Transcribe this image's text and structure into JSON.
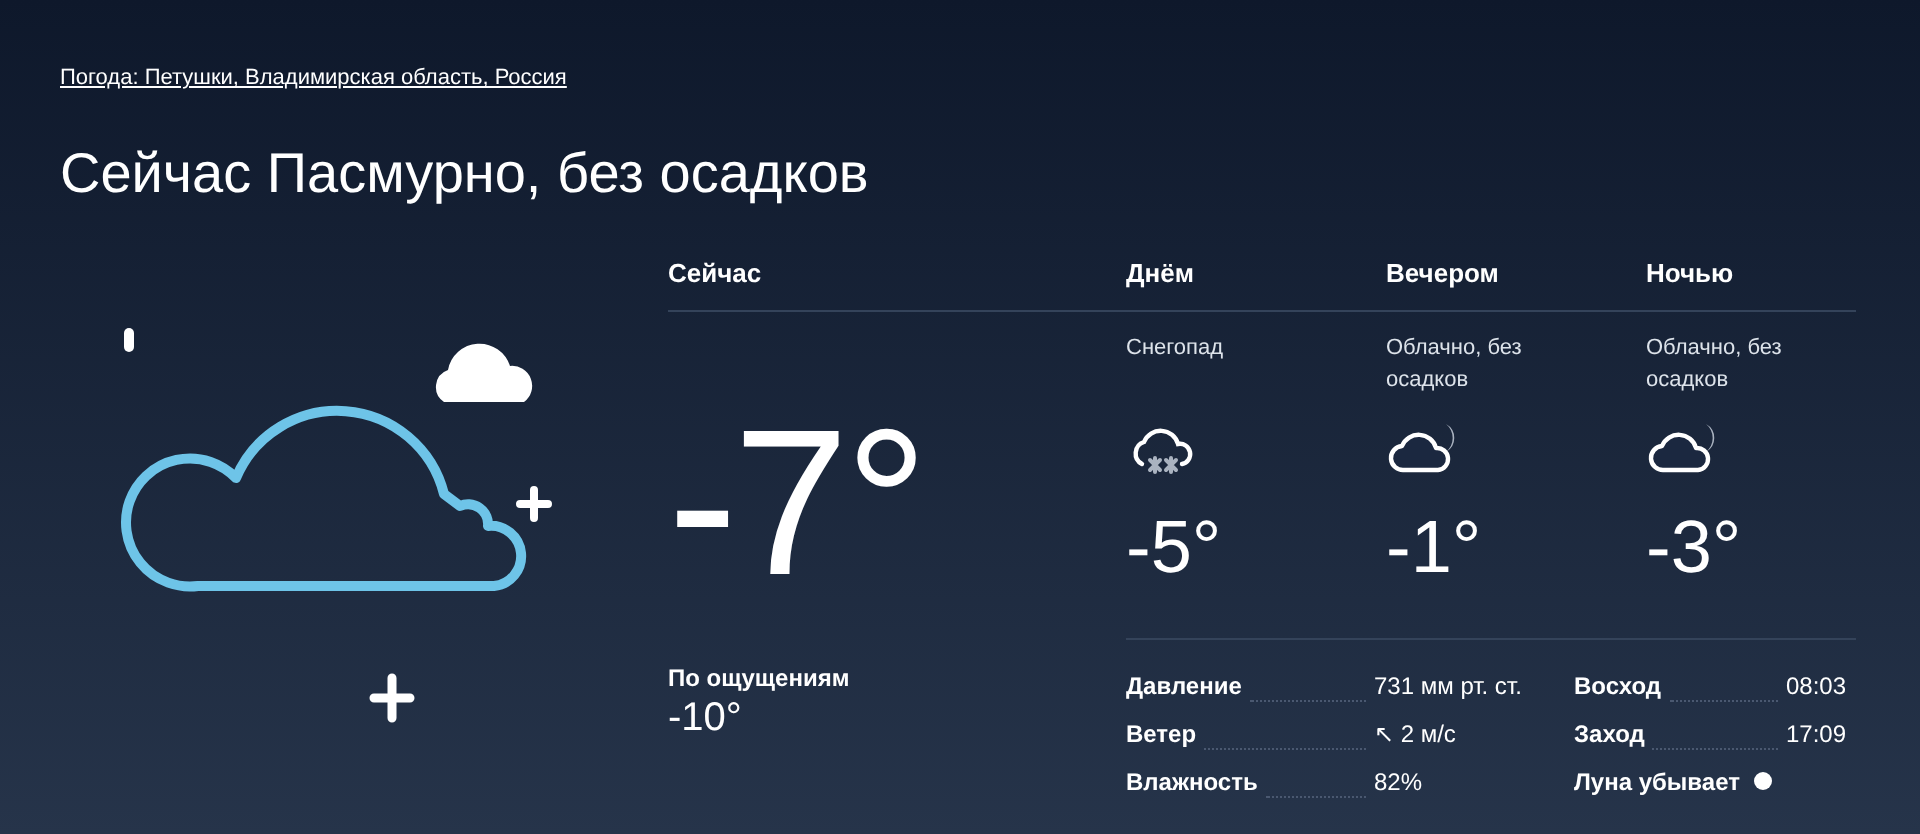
{
  "breadcrumb": "Погода: Петушки, Владимирская область, Россия",
  "title": "Сейчас Пасмурно, без осадков",
  "now": {
    "label": "Сейчас",
    "temperature": "-7°",
    "feels_like_label": "По ощущениям",
    "feels_like": "-10°"
  },
  "periods": [
    {
      "label": "Днём",
      "description": "Снегопад",
      "kind": "snow",
      "temperature": "-5°"
    },
    {
      "label": "Вечером",
      "description": "Облачно, без осадков",
      "kind": "cloudy-night",
      "temperature": "-1°"
    },
    {
      "label": "Ночью",
      "description": "Облачно, без осадков",
      "kind": "cloudy-night",
      "temperature": "-3°"
    }
  ],
  "details": [
    {
      "label": "Давление",
      "value": "731 мм рт. ст."
    },
    {
      "label": "Ветер",
      "value": "↖ 2 м/с"
    },
    {
      "label": "Влажность",
      "value": "82%"
    }
  ],
  "sun": [
    {
      "label": "Восход",
      "value": "08:03",
      "kind": "text"
    },
    {
      "label": "Заход",
      "value": "17:09",
      "kind": "text"
    },
    {
      "label": "Луна убывает",
      "kind": "moon"
    }
  ]
}
